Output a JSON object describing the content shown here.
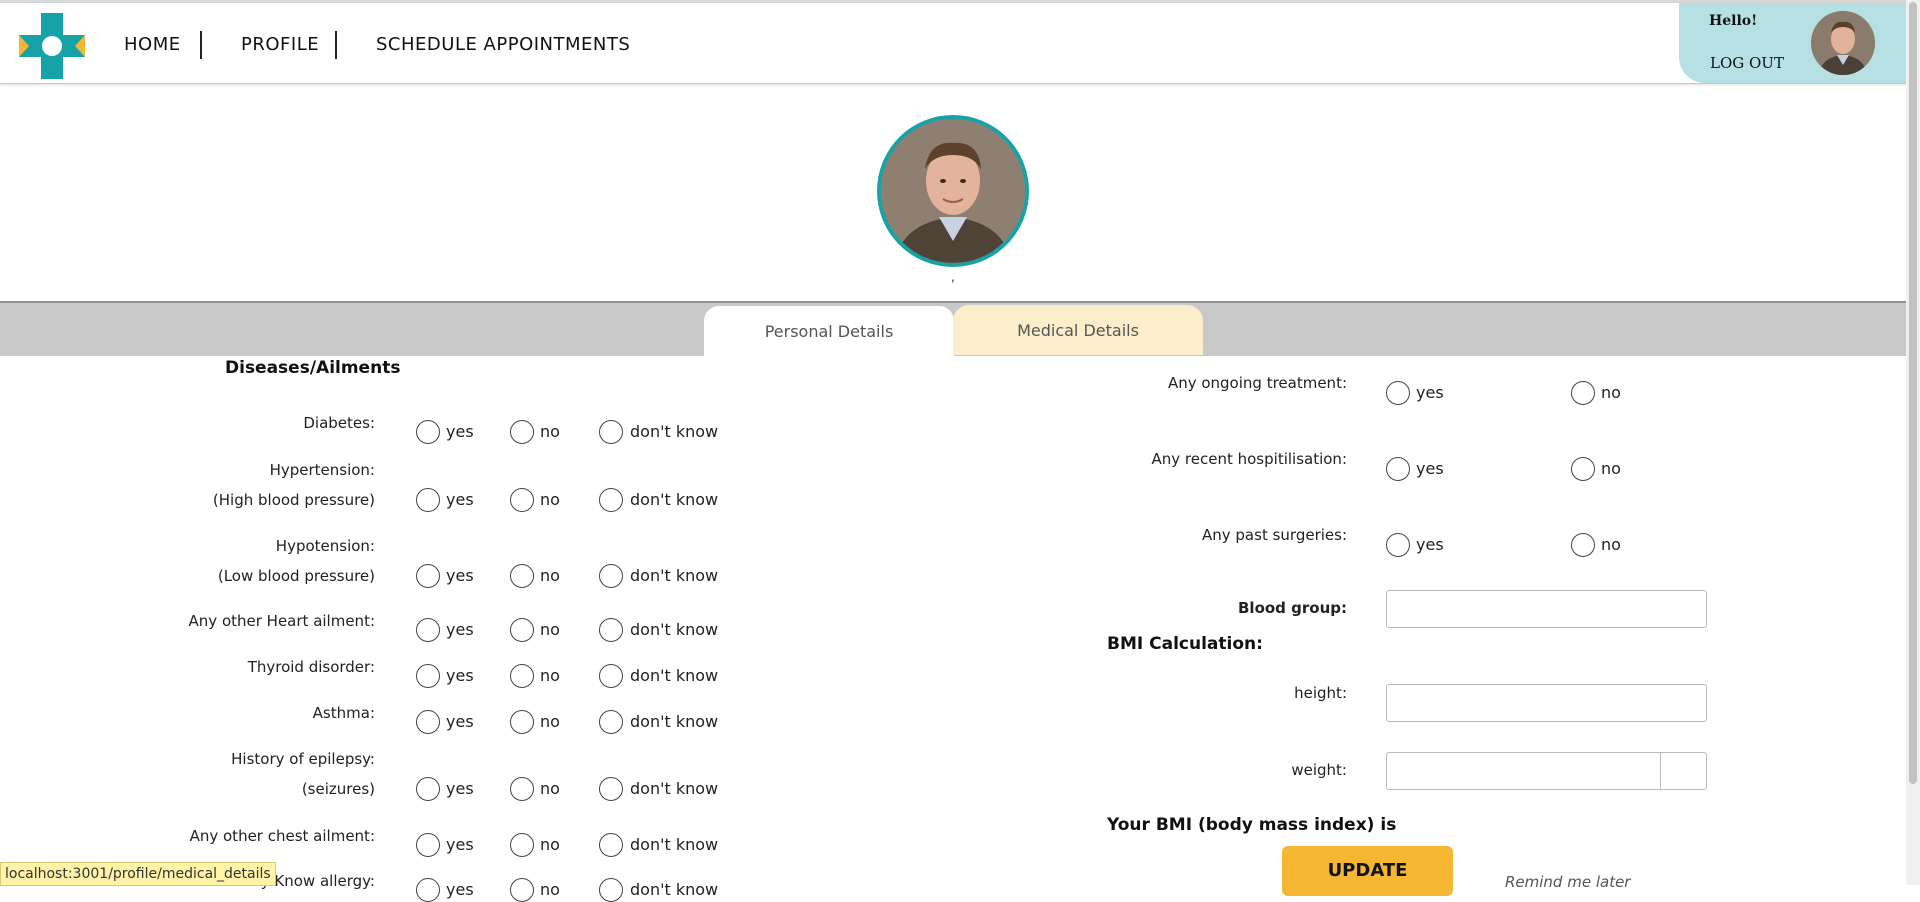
{
  "nav": {
    "items": [
      "HOME",
      "PROFILE",
      "SCHEDULE APPOINTMENTS"
    ]
  },
  "user": {
    "greeting": "Hello!",
    "logout_label": "LOG OUT"
  },
  "profile": {
    "name_placeholder": ","
  },
  "tabs": {
    "personal": "Personal Details",
    "medical": "Medical Details",
    "active": "Medical Details"
  },
  "diseases": {
    "title": "Diseases/Ailments",
    "options": [
      "yes",
      "no",
      "don't know"
    ],
    "questions": [
      {
        "line1": "Diabetes:",
        "line2": ""
      },
      {
        "line1": "Hypertension:",
        "line2": "(High blood pressure)"
      },
      {
        "line1": "Hypotension:",
        "line2": "(Low blood pressure)"
      },
      {
        "line1": "Any other Heart ailment:",
        "line2": ""
      },
      {
        "line1": "Thyroid disorder:",
        "line2": ""
      },
      {
        "line1": "Asthma:",
        "line2": ""
      },
      {
        "line1": "History of epilepsy:",
        "line2": "(seizures)"
      },
      {
        "line1": "Any other chest ailment:",
        "line2": ""
      },
      {
        "line1": "Any Know allergy:",
        "line2": ""
      }
    ]
  },
  "treatment": {
    "options": [
      "yes",
      "no"
    ],
    "questions": [
      "Any ongoing treatment:",
      "Any recent hospitilisation:",
      "Any past surgeries:"
    ]
  },
  "blood_group": {
    "label": "Blood group:",
    "value": ""
  },
  "bmi": {
    "title": "BMI Calculation:",
    "height_label": "height:",
    "weight_label": "weight:",
    "result_label": "Your BMI (body mass index) is"
  },
  "actions": {
    "update": "UPDATE",
    "remind": "Remind me later"
  },
  "status": {
    "url": "localhost:3001/profile/medical_details"
  },
  "colors": {
    "accent": "#17a2a8",
    "user_box": "#b6e0e4",
    "medical_tab": "#fdeecb",
    "update_button": "#f5b632"
  }
}
